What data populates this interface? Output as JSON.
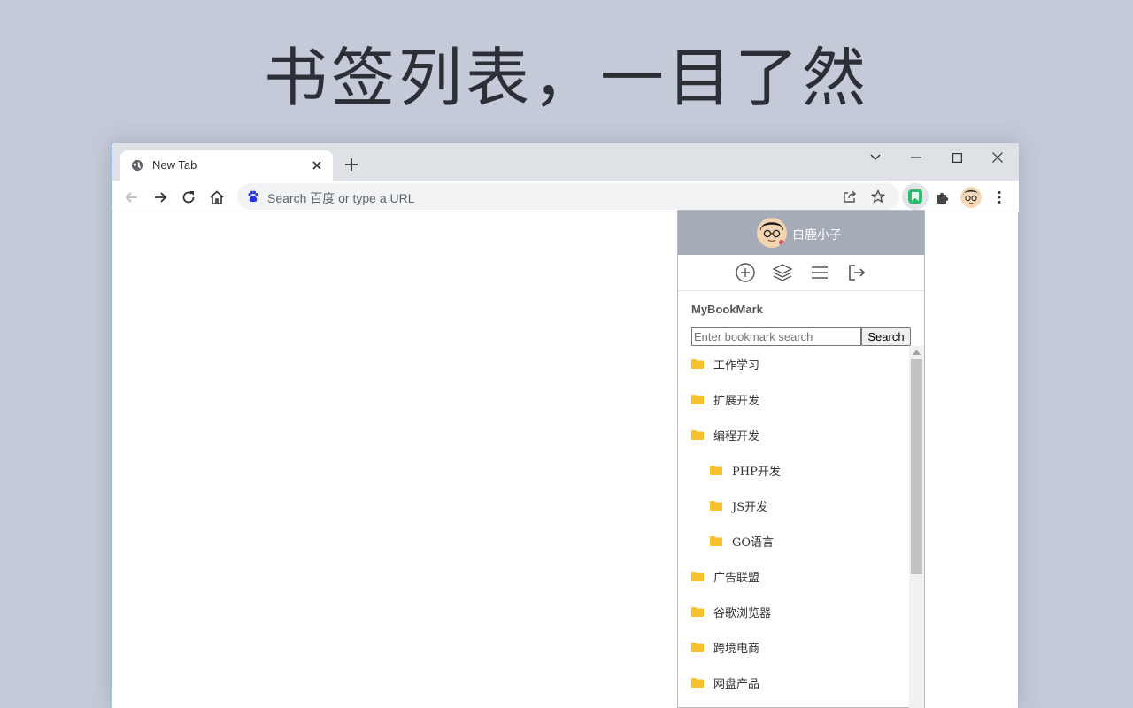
{
  "headline": "书签列表，一目了然",
  "tab": {
    "title": "New Tab"
  },
  "omnibox": {
    "placeholder": "Search 百度 or type a URL"
  },
  "popup": {
    "username": "白鹿小子",
    "title": "MyBookMark",
    "search_placeholder": "Enter bookmark search",
    "search_button": "Search",
    "bookmarks": [
      {
        "label": "工作学习",
        "indent": 0
      },
      {
        "label": "扩展开发",
        "indent": 0
      },
      {
        "label": "编程开发",
        "indent": 0
      },
      {
        "label": "PHP开发",
        "indent": 1
      },
      {
        "label": "JS开发",
        "indent": 1
      },
      {
        "label": "GO语言",
        "indent": 1
      },
      {
        "label": "广告联盟",
        "indent": 0
      },
      {
        "label": "谷歌浏览器",
        "indent": 0
      },
      {
        "label": "跨境电商",
        "indent": 0
      },
      {
        "label": "网盘产品",
        "indent": 0
      }
    ]
  },
  "colors": {
    "background": "#c5cad9",
    "popup_header": "#a6abb8",
    "folder": "#f9c02d",
    "extension_green": "#2bbb6b"
  },
  "icons": [
    "globe-icon",
    "close-icon",
    "plus-icon",
    "back-icon",
    "forward-icon",
    "reload-icon",
    "home-icon",
    "baidu-icon",
    "share-icon",
    "star-icon",
    "bookmark-extension-icon",
    "puzzle-icon",
    "avatar",
    "more-icon",
    "add-circle-icon",
    "layers-icon",
    "menu-icon",
    "logout-icon",
    "folder-icon"
  ]
}
